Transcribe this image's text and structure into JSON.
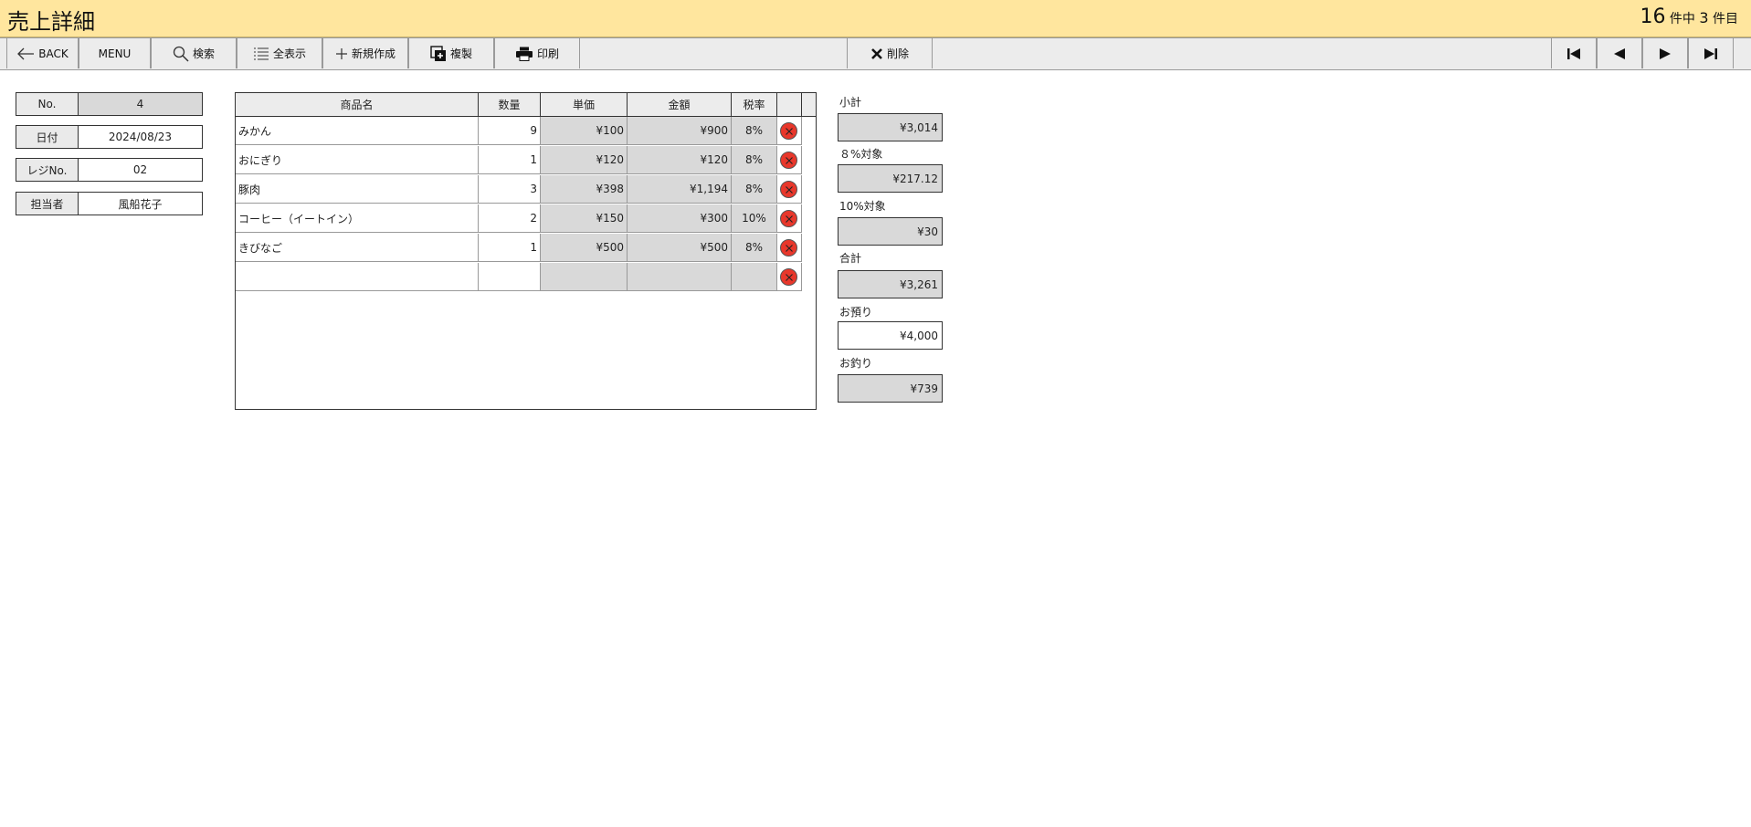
{
  "header": {
    "title": "売上詳細",
    "total_count": "16",
    "of_label": "件中",
    "current_index": "3",
    "unit_label": "件目"
  },
  "toolbar": {
    "back_label": "BACK",
    "menu_label": "MENU",
    "search_label": "検索",
    "show_all_label": "全表示",
    "new_label": "新規作成",
    "duplicate_label": "複製",
    "print_label": "印刷",
    "delete_label": "削除"
  },
  "record": {
    "no_label": "No.",
    "no_value": "4",
    "date_label": "日付",
    "date_value": "2024/08/23",
    "register_label": "レジNo.",
    "register_value": "02",
    "staff_label": "担当者",
    "staff_value": "風船花子"
  },
  "table": {
    "headers": [
      "商品名",
      "数量",
      "単価",
      "金額",
      "税率"
    ],
    "rows": [
      {
        "name": "みかん",
        "qty": "9",
        "price": "¥100",
        "amount": "¥900",
        "tax": "8%"
      },
      {
        "name": "おにぎり",
        "qty": "1",
        "price": "¥120",
        "amount": "¥120",
        "tax": "8%"
      },
      {
        "name": "豚肉",
        "qty": "3",
        "price": "¥398",
        "amount": "¥1,194",
        "tax": "8%"
      },
      {
        "name": "コーヒー（イートイン）",
        "qty": "2",
        "price": "¥150",
        "amount": "¥300",
        "tax": "10%"
      },
      {
        "name": "きびなご",
        "qty": "1",
        "price": "¥500",
        "amount": "¥500",
        "tax": "8%"
      },
      {
        "name": "",
        "qty": "",
        "price": "",
        "amount": "",
        "tax": ""
      }
    ]
  },
  "summary": {
    "subtotal_label": "小計",
    "subtotal_value": "¥3,014",
    "tax8_label": "８%対象",
    "tax8_value": "¥217.12",
    "tax10_label": "10%対象",
    "tax10_value": "¥30",
    "total_label": "合計",
    "total_value": "¥3,261",
    "received_label": "お預り",
    "received_value": "¥4,000",
    "change_label": "お釣り",
    "change_value": "¥739"
  },
  "colors": {
    "titlebar": "#ffe69e",
    "toolbar": "#ececec",
    "delete_icon": "#e8372b",
    "readonly_field": "#d9d9d9"
  }
}
